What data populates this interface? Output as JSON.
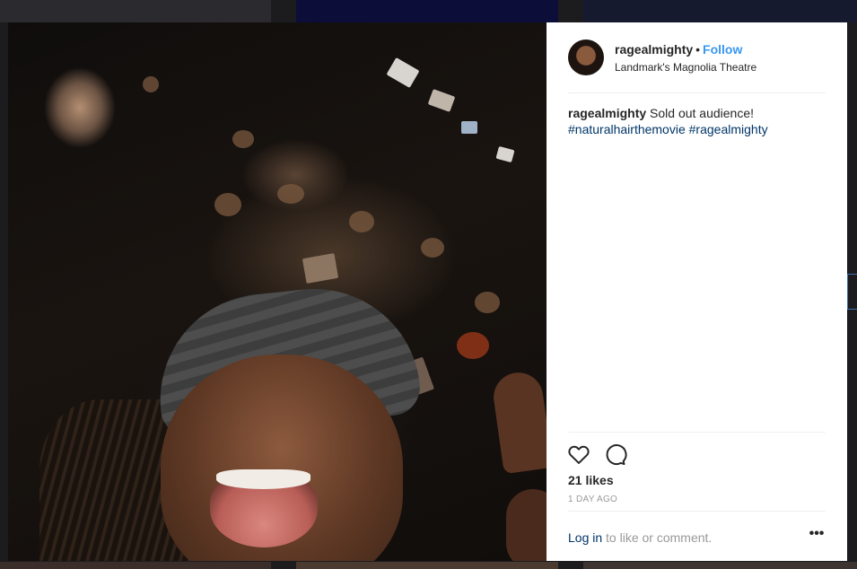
{
  "post": {
    "username": "ragealmighty",
    "separator": "•",
    "follow_label": "Follow",
    "location": "Landmark's Magnolia Theatre",
    "caption_username": "ragealmighty",
    "caption_text": "Sold out audience!",
    "hashtags": [
      "#naturalhairthemovie",
      "#ragealmighty"
    ],
    "likes": "21 likes",
    "time": "1 DAY AGO",
    "login_link": "Log in",
    "login_suffix": "to like or comment.",
    "more_label": "•••"
  },
  "icons": {
    "like": "heart-icon",
    "comment": "comment-icon",
    "more": "more-options-icon"
  },
  "colors": {
    "follow": "#3897f0",
    "hashtag": "#003569",
    "muted": "#999999",
    "text": "#262626"
  }
}
